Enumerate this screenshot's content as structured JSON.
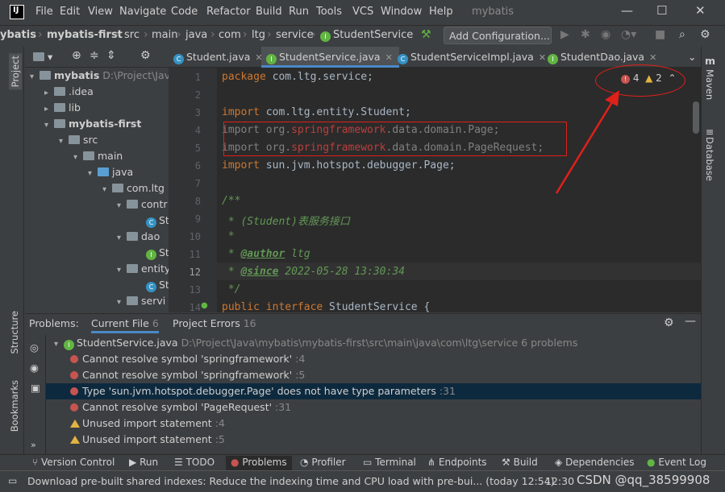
{
  "menu": [
    "File",
    "Edit",
    "View",
    "Navigate",
    "Code",
    "Refactor",
    "Build",
    "Run",
    "Tools",
    "VCS",
    "Window",
    "Help"
  ],
  "window_title": "mybatis",
  "breadcrumbs": [
    "ybatis",
    "mybatis-first",
    "src",
    "main",
    "java",
    "com",
    "ltg",
    "service",
    "StudentService"
  ],
  "add_configuration": "Add Configuration...",
  "project_panel": {
    "title": "Project",
    "tree": [
      {
        "label": "mybatis",
        "extra": "D:\\Project\\Java"
      },
      {
        "label": ".idea"
      },
      {
        "label": "lib"
      },
      {
        "label": "mybatis-first"
      },
      {
        "label": "src"
      },
      {
        "label": "main"
      },
      {
        "label": "java"
      },
      {
        "label": "com.ltg"
      },
      {
        "label": "contr"
      },
      {
        "label": "St"
      },
      {
        "label": "dao"
      },
      {
        "label": "St"
      },
      {
        "label": "entity"
      },
      {
        "label": "St"
      },
      {
        "label": "servi"
      }
    ]
  },
  "tabs": [
    "Student.java",
    "StudentService.java",
    "StudentServiceImpl.java",
    "StudentDao.java"
  ],
  "editor": {
    "line_numbers": [
      "1",
      "2",
      "3",
      "4",
      "5",
      "6",
      "7",
      "8",
      "9",
      "10",
      "11",
      "12",
      "13",
      "14"
    ],
    "lines": {
      "l1_kw": "package",
      "l1_rest": " com.ltg.service;",
      "l3_kw": "import",
      "l3_rest": " com.ltg.entity.Student;",
      "l4_kw": "import",
      "l4_a": " org.",
      "l4_err": "springframework",
      "l4_b": ".data.domain.Page;",
      "l5_kw": "import",
      "l5_a": " org.",
      "l5_err": "springframework",
      "l5_b": ".data.domain.PageRequest;",
      "l6_kw": "import",
      "l6_rest": " sun.jvm.hotspot.debugger.Page;",
      "l8": "/**",
      "l9": " * (Student)表服务接口",
      "l10": " *",
      "l11_star": " * ",
      "l11_tag": "@author",
      "l11_val": " ltg",
      "l12_star": " * ",
      "l12_tag": "@since",
      "l12_val": " 2022-05-28 13:30:34",
      "l13": " */",
      "l14_kw": "public interface",
      "l14_rest": " StudentService {"
    },
    "error_count": "4",
    "warning_count": "2"
  },
  "problems": {
    "tabs": [
      {
        "label": "Problems:",
        "count": ""
      },
      {
        "label": "Current File",
        "count": "6"
      },
      {
        "label": "Project Errors",
        "count": "16"
      }
    ],
    "file": {
      "name": "StudentService.java",
      "path": "D:\\Project\\Java\\mybatis\\mybatis-first\\src\\main\\java\\com\\ltg\\service",
      "summary": "6 problems"
    },
    "items": [
      {
        "severity": "error",
        "text": "Cannot resolve symbol 'springframework'",
        "line": ":4"
      },
      {
        "severity": "error",
        "text": "Cannot resolve symbol 'springframework'",
        "line": ":5"
      },
      {
        "severity": "error",
        "text": "Type 'sun.jvm.hotspot.debugger.Page' does not have type parameters",
        "line": ":31"
      },
      {
        "severity": "error",
        "text": "Cannot resolve symbol 'PageRequest'",
        "line": ":31"
      },
      {
        "severity": "warning",
        "text": "Unused import statement",
        "line": ":4"
      },
      {
        "severity": "warning",
        "text": "Unused import statement",
        "line": ":5"
      }
    ]
  },
  "left_stripe": [
    "Project",
    "Structure",
    "Bookmarks"
  ],
  "right_stripe": [
    "Maven",
    "Database"
  ],
  "toolbar": [
    "Version Control",
    "Run",
    "TODO",
    "Problems",
    "Profiler",
    "Terminal",
    "Endpoints",
    "Build",
    "Dependencies",
    "Event Log"
  ],
  "status": {
    "message": "Download pre-built shared indexes: Reduce the indexing time and CPU load with pre-bui... (today 12:54)",
    "time": "12:30",
    "watermark": "CSDN @qq_38599908"
  },
  "colors": {
    "accent": "#4a88c7",
    "error": "#c75450",
    "warning": "#e3b341",
    "annotation": "#e0201a"
  }
}
